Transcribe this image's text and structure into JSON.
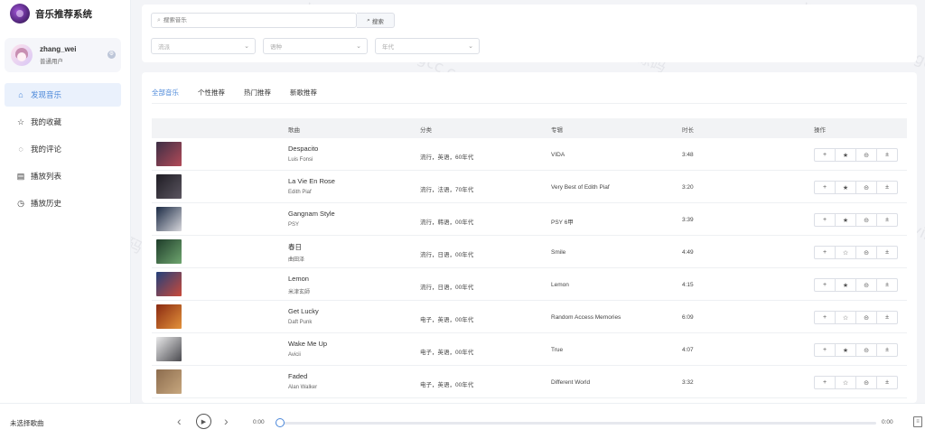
{
  "app": {
    "title": "音乐推荐系统"
  },
  "user": {
    "name": "zhang_wei",
    "role": "普通用户"
  },
  "sidebar": {
    "items": [
      {
        "label": "发现音乐",
        "icon": "home-icon",
        "active": true
      },
      {
        "label": "我的收藏",
        "icon": "star-icon",
        "active": false
      },
      {
        "label": "我的评论",
        "icon": "comment-icon",
        "active": false
      },
      {
        "label": "播放列表",
        "icon": "list-icon",
        "active": false
      },
      {
        "label": "播放历史",
        "icon": "clock-icon",
        "active": false
      }
    ]
  },
  "filters": {
    "search_placeholder": "搜索音乐",
    "search_button": "搜索",
    "selects": [
      {
        "placeholder": "流派"
      },
      {
        "placeholder": "语种"
      },
      {
        "placeholder": "年代"
      }
    ]
  },
  "tabs": [
    {
      "label": "全部音乐",
      "active": true
    },
    {
      "label": "个性推荐",
      "active": false
    },
    {
      "label": "热门推荐",
      "active": false
    },
    {
      "label": "新歌推荐",
      "active": false
    }
  ],
  "table": {
    "columns": {
      "song": "歌曲",
      "category": "分类",
      "album": "专辑",
      "duration": "时长",
      "actions": "操作"
    },
    "rows": [
      {
        "title": "Despacito",
        "artist": "Luis Fonsi",
        "category": "流行，英语，60年代",
        "album": "VIDA",
        "duration": "3:48",
        "favorited": true,
        "cover": [
          "#3d2f45",
          "#b24a58"
        ]
      },
      {
        "title": "La Vie En Rose",
        "artist": "Edith Piaf",
        "category": "流行，法语，70年代",
        "album": "Very Best of Edith Piaf",
        "duration": "3:20",
        "favorited": true,
        "cover": [
          "#1f1d24",
          "#5b5560"
        ]
      },
      {
        "title": "Gangnam Style",
        "artist": "PSY",
        "category": "流行，韩语，00年代",
        "album": "PSY 6甲",
        "duration": "3:39",
        "favorited": true,
        "cover": [
          "#1b2a44",
          "#d7d7dc"
        ]
      },
      {
        "title": "春日",
        "artist": "曲田泽",
        "category": "流行，日语，00年代",
        "album": "Smile",
        "duration": "4:49",
        "favorited": false,
        "cover": [
          "#1e3c2a",
          "#6fa66f"
        ]
      },
      {
        "title": "Lemon",
        "artist": "米津玄師",
        "category": "流行，日语，00年代",
        "album": "Lemon",
        "duration": "4:15",
        "favorited": true,
        "cover": [
          "#23407a",
          "#c94a3a"
        ]
      },
      {
        "title": "Get Lucky",
        "artist": "Daft Punk",
        "category": "电子，英语，00年代",
        "album": "Random Access Memories",
        "duration": "6:09",
        "favorited": false,
        "cover": [
          "#8a2a12",
          "#e3923a"
        ]
      },
      {
        "title": "Wake Me Up",
        "artist": "Avicii",
        "category": "电子，英语，00年代",
        "album": "True",
        "duration": "4:07",
        "favorited": true,
        "cover": [
          "#e9e9ea",
          "#4a4a4f"
        ]
      },
      {
        "title": "Faded",
        "artist": "Alan Walker",
        "category": "电子，英语，00年代",
        "album": "Different World",
        "duration": "3:32",
        "favorited": false,
        "cover": [
          "#8c6c4e",
          "#c7a77e"
        ]
      }
    ],
    "actions": {
      "add": "+",
      "fav_on": "★",
      "fav_off": "☆",
      "comment": "⊝",
      "download": "±"
    }
  },
  "player": {
    "now_playing": "未选择歌曲",
    "current_time": "0:00",
    "total_time": "0:00",
    "progress": 0
  },
  "watermark": {
    "line1": "©猫头鹰源码",
    "line2": "www.maotouyingcc.com"
  }
}
